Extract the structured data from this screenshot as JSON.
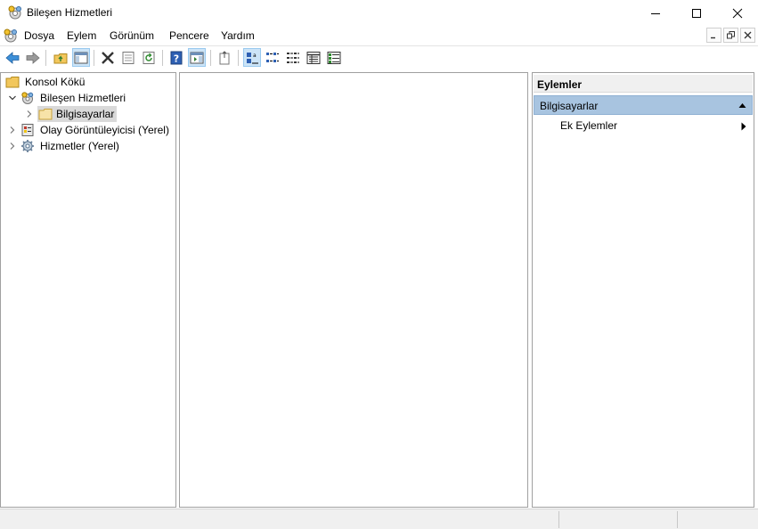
{
  "window": {
    "title": "Bileşen Hizmetleri"
  },
  "menu": {
    "items": [
      "Dosya",
      "Eylem",
      "Görünüm",
      "Pencere",
      "Yardım"
    ]
  },
  "toolbar": {
    "buttons": [
      "back-icon",
      "forward-icon",
      "up-folder-icon",
      "show-hide-tree-icon",
      "delete-icon",
      "properties-icon",
      "refresh-icon",
      "help-icon",
      "show-hide-action-pane-icon",
      "export-list-icon",
      "large-icons-view-icon",
      "small-icons-view-icon",
      "list-view-icon",
      "details-view-icon",
      "properties-view-icon"
    ]
  },
  "tree": {
    "items": [
      {
        "label": "Konsol Kökü",
        "icon": "folder-icon",
        "expand": "none"
      },
      {
        "label": "Bileşen Hizmetleri",
        "icon": "component-services-icon",
        "expand": "expanded"
      },
      {
        "label": "Bilgisayarlar",
        "icon": "folder-icon",
        "expand": "collapsed",
        "selected": true
      },
      {
        "label": "Olay Görüntüleyicisi (Yerel)",
        "icon": "event-viewer-icon",
        "expand": "collapsed"
      },
      {
        "label": "Hizmetler (Yerel)",
        "icon": "services-gear-icon",
        "expand": "collapsed"
      }
    ]
  },
  "actions": {
    "header": "Eylemler",
    "section": "Bilgisayarlar",
    "items": [
      {
        "label": "Ek Eylemler"
      }
    ]
  },
  "colors": {
    "section_bg": "#a8c4e0",
    "pressed_bg": "#cce4f7",
    "selected_bg": "#d9d9d9"
  }
}
